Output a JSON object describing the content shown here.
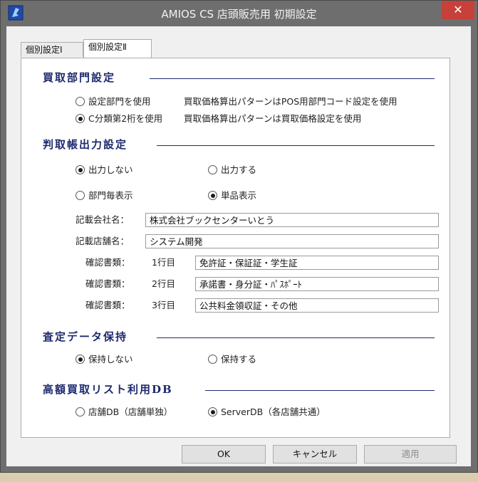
{
  "window": {
    "title": "AMIOS CS 店頭販売用  初期設定",
    "close_glyph": "✕"
  },
  "tabs": [
    {
      "label": "個別設定Ⅰ",
      "active": false
    },
    {
      "label": "個別設定Ⅱ",
      "active": true
    }
  ],
  "purchase_dept": {
    "heading": "買取部門設定",
    "options": [
      {
        "label": "設定部門を使用",
        "description": "買取価格算出パターンはPOS用部門コード設定を使用",
        "selected": false
      },
      {
        "label": "C分類第2桁を使用",
        "description": "買取価格算出パターンは買取価格設定を使用",
        "selected": true
      }
    ]
  },
  "ledger_output": {
    "heading": "判取帳出力設定",
    "output_options": [
      {
        "label": "出力しない",
        "selected": true
      },
      {
        "label": "出力する",
        "selected": false
      }
    ],
    "display_options": [
      {
        "label": "部門毎表示",
        "selected": false
      },
      {
        "label": "単品表示",
        "selected": true
      }
    ],
    "company_label": "記載会社名：",
    "company_value": "株式会社ブックセンターいとう",
    "store_label": "記載店舗名：",
    "store_value": "システム開発",
    "documents": [
      {
        "label": "確認書類：",
        "line": "1行目",
        "value": "免許証・保証証・学生証"
      },
      {
        "label": "確認書類：",
        "line": "2行目",
        "value": "承諾書・身分証・ﾊﾟｽﾎﾟｰﾄ"
      },
      {
        "label": "確認書類：",
        "line": "3行目",
        "value": "公共料金領収証・その他"
      }
    ]
  },
  "assessment": {
    "heading": "査定データ保持",
    "options": [
      {
        "label": "保持しない",
        "selected": true
      },
      {
        "label": "保持する",
        "selected": false
      }
    ]
  },
  "high_value_db": {
    "heading": "高額買取リスト利用DB",
    "options": [
      {
        "label": "店舗DB（店舗単独）",
        "selected": false
      },
      {
        "label": "ServerDB（各店舗共通）",
        "selected": true
      }
    ]
  },
  "buttons": {
    "ok": "OK",
    "cancel": "キャンセル",
    "apply": "適用"
  },
  "colors": {
    "section_heading": "#1e2a6e",
    "titlebar": "#6e6e6e",
    "close_button": "#c7403a"
  }
}
